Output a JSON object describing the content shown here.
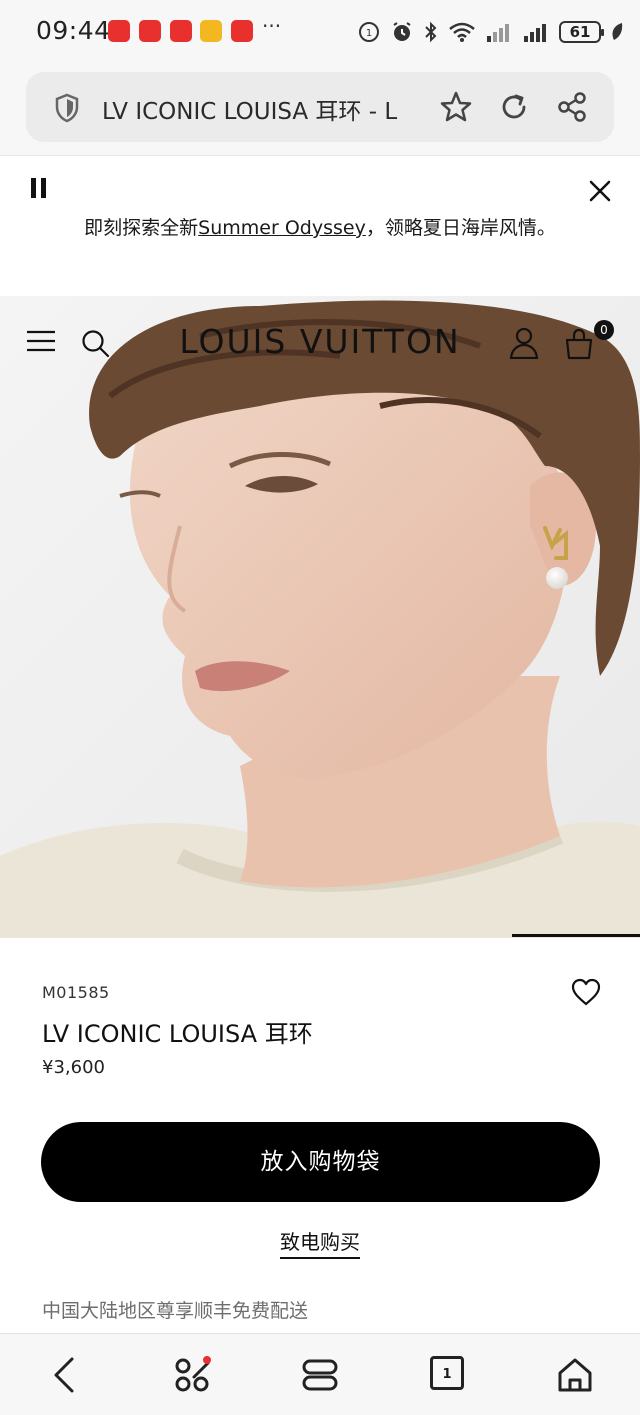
{
  "status_bar": {
    "time": "09:44",
    "battery": "61",
    "notification_colors": [
      "#e8302f",
      "#e8302f",
      "#e8302f",
      "#f3b820",
      "#e8302f"
    ]
  },
  "browser": {
    "url_text": "LV ICONIC LOUISA 耳环 - L"
  },
  "promo": {
    "text_before": "即刻探索全新",
    "link_text": "Summer Odyssey",
    "text_after": "，领略夏日海岸风情。"
  },
  "site_header": {
    "brand": "LOUIS VUITTON",
    "bag_count": "0"
  },
  "product": {
    "sku": "M01585",
    "name": "LV ICONIC LOUISA 耳环",
    "price": "¥3,600",
    "add_to_bag_label": "放入购物袋",
    "call_to_buy_label": "致电购买",
    "shipping_note": "中国大陆地区尊享顺丰免费配送"
  },
  "bottom_nav": {
    "tab_count": "1"
  },
  "colors": {
    "primary_button": "#000000",
    "status_notification": "#e8302f"
  }
}
